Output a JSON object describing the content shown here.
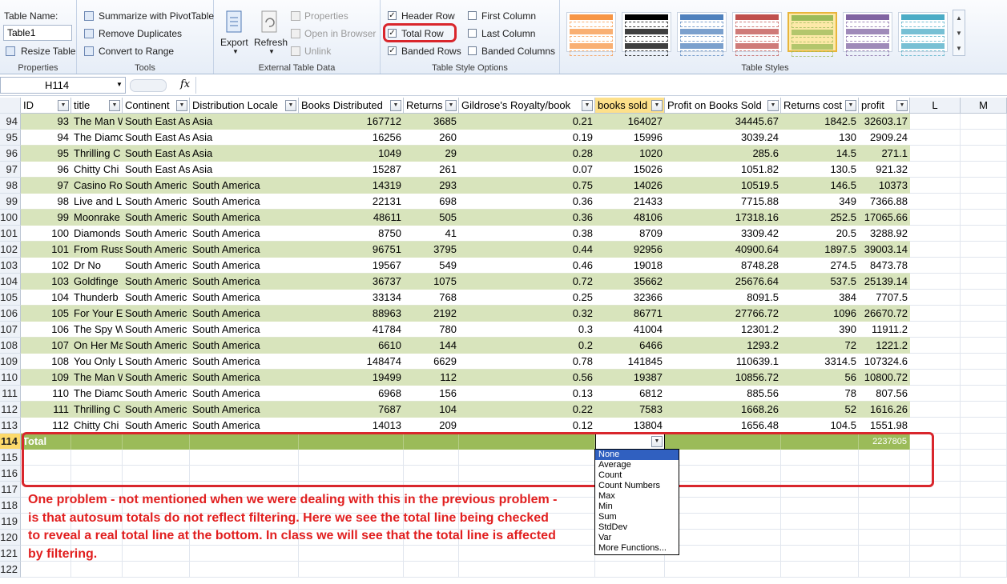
{
  "ribbon": {
    "properties": {
      "table_name_label": "Table Name:",
      "table_name_value": "Table1",
      "resize_label": "Resize Table",
      "group_label": "Properties"
    },
    "tools": {
      "pivot_label": "Summarize with PivotTable",
      "remove_dup_label": "Remove Duplicates",
      "convert_label": "Convert to Range",
      "group_label": "Tools"
    },
    "external": {
      "export_label": "Export",
      "refresh_label": "Refresh",
      "properties_label": "Properties",
      "open_browser_label": "Open in Browser",
      "unlink_label": "Unlink",
      "group_label": "External Table Data"
    },
    "style_options": {
      "header_row": "Header Row",
      "total_row": "Total Row",
      "banded_rows": "Banded Rows",
      "first_column": "First Column",
      "last_column": "Last Column",
      "banded_columns": "Banded Columns",
      "group_label": "Table Style Options",
      "header_row_checked": true,
      "total_row_checked": true,
      "banded_rows_checked": true,
      "first_column_checked": false,
      "last_column_checked": false,
      "banded_columns_checked": false
    },
    "table_styles": {
      "group_label": "Table Styles",
      "colors": [
        "#f79646",
        "#000000",
        "#4f81bd",
        "#c0504d",
        "#9bbb59",
        "#8064a2",
        "#4bacc6"
      ],
      "selected_index": 4
    }
  },
  "formula_bar": {
    "name_box": "H114",
    "fx": "fx",
    "formula": ""
  },
  "columns": {
    "letters": [
      "L",
      "M"
    ],
    "headers": [
      "ID",
      "title",
      "Continent",
      "Distribution Locale",
      "Books Distributed",
      "Returns",
      "Gildrose's Royalty/book",
      "books sold",
      "Profit on Books Sold",
      "Returns cost",
      "profit"
    ]
  },
  "rows": [
    {
      "n": "94",
      "c": [
        "93",
        "The Man W",
        "South East As",
        "Asia",
        "167712",
        "3685",
        "0.21",
        "164027",
        "34445.67",
        "1842.5",
        "32603.17"
      ]
    },
    {
      "n": "95",
      "c": [
        "94",
        "The Diamo",
        "South East As",
        "Asia",
        "16256",
        "260",
        "0.19",
        "15996",
        "3039.24",
        "130",
        "2909.24"
      ]
    },
    {
      "n": "96",
      "c": [
        "95",
        "Thrilling C",
        "South East As",
        "Asia",
        "1049",
        "29",
        "0.28",
        "1020",
        "285.6",
        "14.5",
        "271.1"
      ]
    },
    {
      "n": "97",
      "c": [
        "96",
        "Chitty Chi",
        "South East As",
        "Asia",
        "15287",
        "261",
        "0.07",
        "15026",
        "1051.82",
        "130.5",
        "921.32"
      ]
    },
    {
      "n": "98",
      "c": [
        "97",
        "Casino Ro",
        "South Americ",
        "South America",
        "14319",
        "293",
        "0.75",
        "14026",
        "10519.5",
        "146.5",
        "10373"
      ]
    },
    {
      "n": "99",
      "c": [
        "98",
        "Live and L",
        "South Americ",
        "South America",
        "22131",
        "698",
        "0.36",
        "21433",
        "7715.88",
        "349",
        "7366.88"
      ]
    },
    {
      "n": "100",
      "c": [
        "99",
        "Moonrake",
        "South Americ",
        "South America",
        "48611",
        "505",
        "0.36",
        "48106",
        "17318.16",
        "252.5",
        "17065.66"
      ]
    },
    {
      "n": "101",
      "c": [
        "100",
        "Diamonds",
        "South Americ",
        "South America",
        "8750",
        "41",
        "0.38",
        "8709",
        "3309.42",
        "20.5",
        "3288.92"
      ]
    },
    {
      "n": "102",
      "c": [
        "101",
        "From Russ",
        "South Americ",
        "South America",
        "96751",
        "3795",
        "0.44",
        "92956",
        "40900.64",
        "1897.5",
        "39003.14"
      ]
    },
    {
      "n": "103",
      "c": [
        "102",
        "Dr No",
        "South Americ",
        "South America",
        "19567",
        "549",
        "0.46",
        "19018",
        "8748.28",
        "274.5",
        "8473.78"
      ]
    },
    {
      "n": "104",
      "c": [
        "103",
        "Goldfinge",
        "South Americ",
        "South America",
        "36737",
        "1075",
        "0.72",
        "35662",
        "25676.64",
        "537.5",
        "25139.14"
      ]
    },
    {
      "n": "105",
      "c": [
        "104",
        "Thunderb",
        "South Americ",
        "South America",
        "33134",
        "768",
        "0.25",
        "32366",
        "8091.5",
        "384",
        "7707.5"
      ]
    },
    {
      "n": "106",
      "c": [
        "105",
        "For Your E",
        "South Americ",
        "South America",
        "88963",
        "2192",
        "0.32",
        "86771",
        "27766.72",
        "1096",
        "26670.72"
      ]
    },
    {
      "n": "107",
      "c": [
        "106",
        "The Spy W",
        "South Americ",
        "South America",
        "41784",
        "780",
        "0.3",
        "41004",
        "12301.2",
        "390",
        "11911.2"
      ]
    },
    {
      "n": "108",
      "c": [
        "107",
        "On Her Ma",
        "South Americ",
        "South America",
        "6610",
        "144",
        "0.2",
        "6466",
        "1293.2",
        "72",
        "1221.2"
      ]
    },
    {
      "n": "109",
      "c": [
        "108",
        "You Only L",
        "South Americ",
        "South America",
        "148474",
        "6629",
        "0.78",
        "141845",
        "110639.1",
        "3314.5",
        "107324.6"
      ]
    },
    {
      "n": "110",
      "c": [
        "109",
        "The Man W",
        "South Americ",
        "South America",
        "19499",
        "112",
        "0.56",
        "19387",
        "10856.72",
        "56",
        "10800.72"
      ]
    },
    {
      "n": "111",
      "c": [
        "110",
        "The Diamo",
        "South Americ",
        "South America",
        "6968",
        "156",
        "0.13",
        "6812",
        "885.56",
        "78",
        "807.56"
      ]
    },
    {
      "n": "112",
      "c": [
        "111",
        "Thrilling C",
        "South Americ",
        "South America",
        "7687",
        "104",
        "0.22",
        "7583",
        "1668.26",
        "52",
        "1616.26"
      ]
    },
    {
      "n": "113",
      "c": [
        "112",
        "Chitty Chi",
        "South Americ",
        "South America",
        "14013",
        "209",
        "0.12",
        "13804",
        "1656.48",
        "104.5",
        "1551.98"
      ]
    }
  ],
  "total_row": {
    "n": "114",
    "label": "Total",
    "profit": "2237805"
  },
  "empty_rows": [
    "115",
    "116",
    "117",
    "118",
    "119",
    "120",
    "121",
    "122"
  ],
  "dropdown": {
    "items": [
      "None",
      "Average",
      "Count",
      "Count Numbers",
      "Max",
      "Min",
      "Sum",
      "StdDev",
      "Var",
      "More Functions..."
    ],
    "selected": "None"
  },
  "annotation": {
    "lines": [
      "One problem - not mentioned when we were dealing with this in the previous problem -",
      "is that autosum totals do not reflect filtering. Here we see the total line being checked",
      "to reveal a real total line at the bottom. In class we will see  that the total line is affected",
      " by filtering."
    ],
    "color": "#e11f1f"
  }
}
